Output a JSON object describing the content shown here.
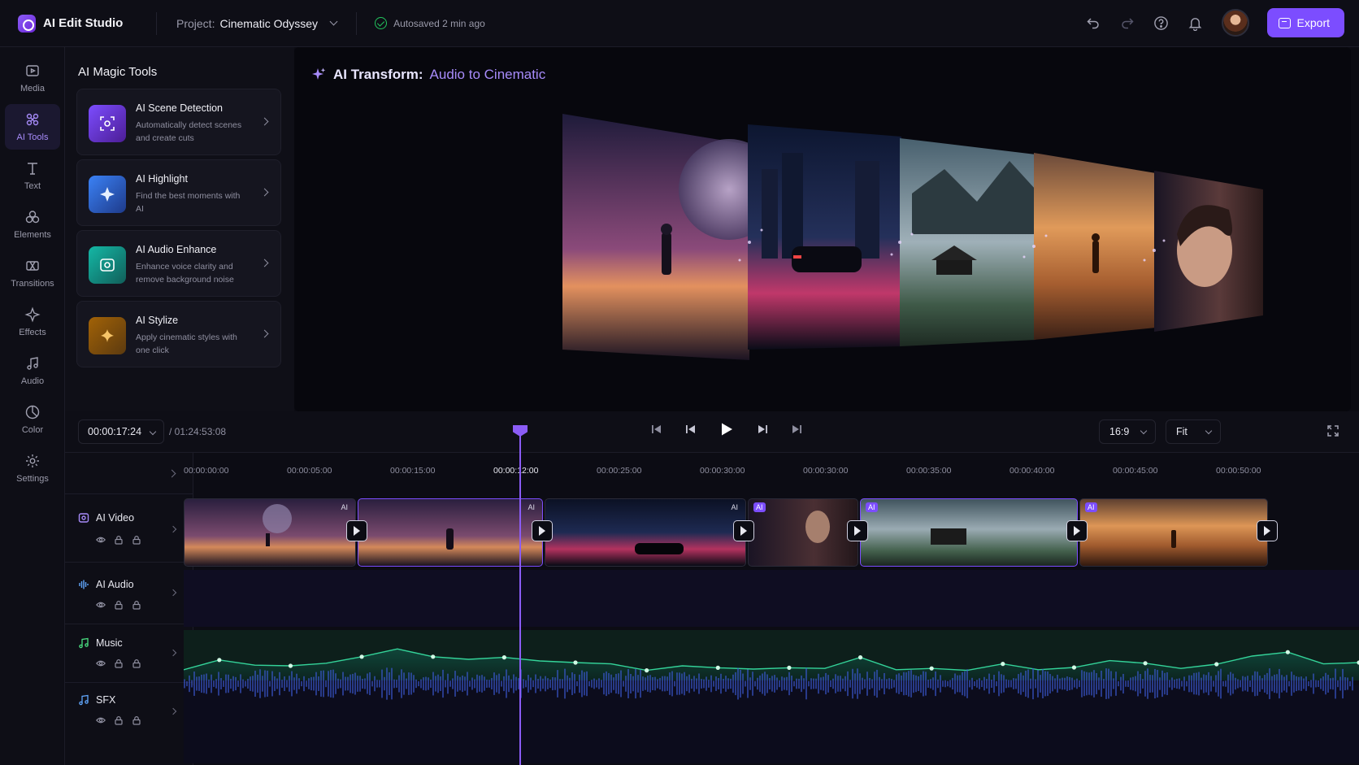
{
  "app": {
    "name": "AI Edit Studio",
    "accent": "#7c4dff"
  },
  "header": {
    "project_label": "Project:",
    "project_name": "Cinematic Odyssey",
    "autosave": "Autosaved 2 min ago",
    "export_label": "Export"
  },
  "rail": {
    "items": [
      {
        "label": "Media",
        "icon": "media-icon"
      },
      {
        "label": "AI Tools",
        "icon": "ai-tools-icon",
        "active": true
      },
      {
        "label": "Text",
        "icon": "text-icon"
      },
      {
        "label": "Elements",
        "icon": "elements-icon"
      },
      {
        "label": "Transitions",
        "icon": "transitions-icon"
      },
      {
        "label": "Effects",
        "icon": "effects-icon"
      },
      {
        "label": "Audio",
        "icon": "audio-icon"
      },
      {
        "label": "Color",
        "icon": "color-icon"
      },
      {
        "label": "Settings",
        "icon": "settings-icon"
      }
    ]
  },
  "tools_panel": {
    "title": "AI Magic Tools",
    "cards": [
      {
        "name": "AI Scene Detection",
        "desc": "Automatically detect scenes and create cuts",
        "icon": "scene-detection-icon",
        "color": "#6d3bd8"
      },
      {
        "name": "AI Highlight",
        "desc": "Find the best moments with AI",
        "icon": "highlight-icon",
        "color": "#2f5fd8"
      },
      {
        "name": "AI Audio Enhance",
        "desc": "Enhance voice clarity and remove background noise",
        "icon": "audio-enhance-icon",
        "color": "#13707a"
      },
      {
        "name": "AI Stylize",
        "desc": "Apply cinematic styles with one click",
        "icon": "stylize-icon",
        "color": "#8a5a1c"
      }
    ]
  },
  "preview": {
    "title_prefix": "AI Transform:",
    "title_suffix": "Audio to Cinematic"
  },
  "transport": {
    "timecode": "00:00:17:24",
    "duration": "/ 01:24:53:08",
    "aspect": "16:9",
    "zoom": "Fit"
  },
  "timeline": {
    "ticks": [
      "00:00:00:00",
      "00:00:05:00",
      "00:00:15:00",
      "00:00:12:00",
      "00:00:25:00",
      "00:00:30:00",
      "00:00:30:00",
      "00:00:35:00",
      "00:00:40:00",
      "00:00:45:00",
      "00:00:50:00"
    ],
    "tracks": [
      {
        "name": "AI Video",
        "icon": "video-track-icon"
      },
      {
        "name": "AI Audio",
        "icon": "audio-track-icon"
      },
      {
        "name": "Music",
        "icon": "music-track-icon"
      },
      {
        "name": "SFX",
        "icon": "sfx-track-icon"
      }
    ],
    "clip_badge": "AI",
    "clips": [
      {
        "scene": "astronaut-moon",
        "badge_style": "plain"
      },
      {
        "scene": "astronaut-closeup",
        "badge_style": "plain"
      },
      {
        "scene": "neon-city-car",
        "badge_style": "plain"
      },
      {
        "scene": "portrait-neon",
        "badge_style": "purple"
      },
      {
        "scene": "misty-temple",
        "badge_style": "purple"
      },
      {
        "scene": "desert-sunset",
        "badge_style": "purple"
      }
    ],
    "music_points": [
      0.08,
      0.38,
      0.22,
      0.2,
      0.28,
      0.48,
      0.72,
      0.48,
      0.4,
      0.46,
      0.35,
      0.3,
      0.26,
      0.06,
      0.2,
      0.14,
      0.1,
      0.14,
      0.12,
      0.46,
      0.08,
      0.12,
      0.06,
      0.26,
      0.08,
      0.15,
      0.36,
      0.28,
      0.12,
      0.25,
      0.5,
      0.62,
      0.26,
      0.3
    ]
  }
}
